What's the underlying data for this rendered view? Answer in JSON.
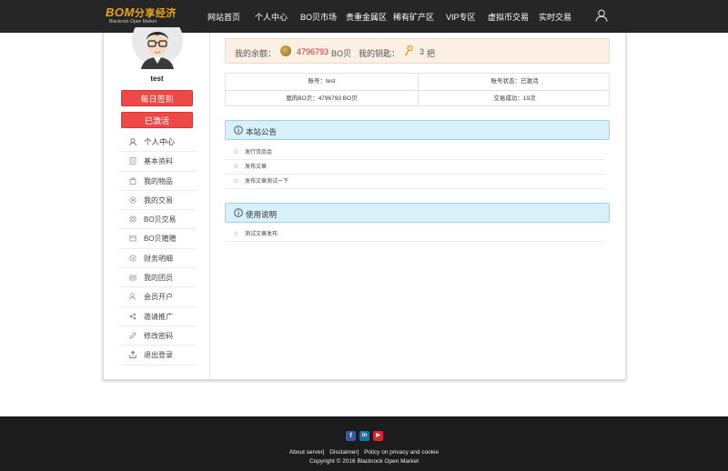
{
  "header": {
    "logo_text": "BOM",
    "logo_cn": "分享经济",
    "logo_sub": "Blackrock Open Market",
    "nav": [
      "网站首页",
      "个人中心",
      "BO贝市场",
      "贵重金属区",
      "稀有矿产区",
      "VIP专区",
      "虚拟币交易",
      "实时交易"
    ],
    "user_icon": "user-icon"
  },
  "sidebar": {
    "username": "test",
    "sign_in_button": "每日签到",
    "activated_button": "已激活",
    "menu": [
      {
        "label": "个人中心",
        "icon": "user-icon"
      },
      {
        "label": "基本资料",
        "icon": "profile-icon"
      },
      {
        "label": "我的物品",
        "icon": "bag-icon"
      },
      {
        "label": "我的交易",
        "icon": "trade-icon"
      },
      {
        "label": "BO贝交易",
        "icon": "coin-trade-icon"
      },
      {
        "label": "BO贝赠赠",
        "icon": "gift-icon"
      },
      {
        "label": "财务明细",
        "icon": "finance-icon"
      },
      {
        "label": "我的团员",
        "icon": "team-icon"
      },
      {
        "label": "会员开户",
        "icon": "add-member-icon"
      },
      {
        "label": "邀请推广",
        "icon": "share-icon"
      },
      {
        "label": "修改密码",
        "icon": "pencil-icon"
      },
      {
        "label": "退出登录",
        "icon": "logout-icon"
      }
    ]
  },
  "balance": {
    "label": "我的余额：",
    "amount": "4796793",
    "unit": "BO贝",
    "keys_label": "我的钥匙：",
    "keys": "3",
    "keys_unit": "把"
  },
  "account_info": {
    "account": "账号：test",
    "status": "账号状态：已激活",
    "bo_balance": "我的BO贝：4796793 BO贝",
    "trades": "交易成功：19次"
  },
  "announcements": {
    "title": "本站公告",
    "items": [
      "发行货品金",
      "发布文章",
      "发布文章测试一下"
    ]
  },
  "instructions": {
    "title": "使用说明",
    "items": [
      "测试文章发布"
    ]
  },
  "footer": {
    "link_about": "About server|",
    "link_disclaimer": "Disclaimer|",
    "link_privacy": "Policy on privacy and cookie",
    "copyright": "Copyright © 2016 Blackrock Open Market",
    "social": [
      {
        "name": "facebook-icon",
        "glyph": "f",
        "color": "#3b5998"
      },
      {
        "name": "linkedin-icon",
        "glyph": "in",
        "color": "#0e76a8"
      },
      {
        "name": "youtube-icon",
        "glyph": "▶",
        "color": "#d8262a"
      }
    ]
  },
  "colors": {
    "topbar": "#262626",
    "accent_red": "#f04848",
    "amount_red": "#d8262a",
    "balance_bg": "#fcefe4",
    "panel_head_bg": "#d7f0fa",
    "footer_bg": "#1c1c1c"
  }
}
